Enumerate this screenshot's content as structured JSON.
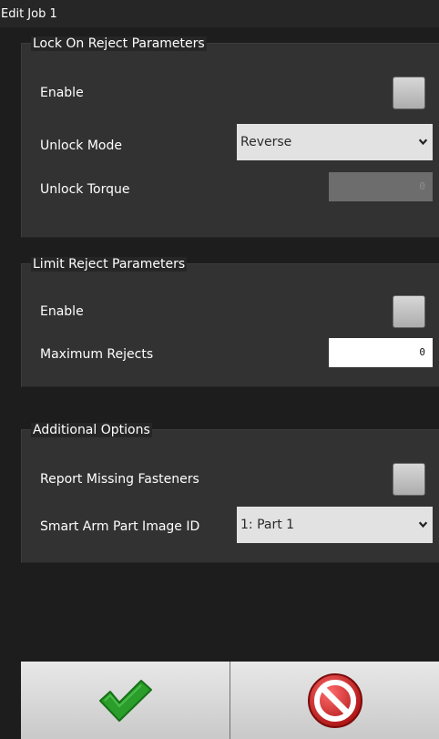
{
  "window": {
    "title": "Edit Job 1"
  },
  "lock_on_reject": {
    "legend": "Lock On Reject Parameters",
    "enable_label": "Enable",
    "enable_checked": false,
    "unlock_mode_label": "Unlock Mode",
    "unlock_mode_value": "Reverse",
    "unlock_torque_label": "Unlock Torque",
    "unlock_torque_value": "0"
  },
  "limit_reject": {
    "legend": "Limit Reject Parameters",
    "enable_label": "Enable",
    "enable_checked": false,
    "max_rejects_label": "Maximum Rejects",
    "max_rejects_value": "0"
  },
  "additional_options": {
    "legend": "Additional Options",
    "report_missing_label": "Report Missing Fasteners",
    "report_missing_checked": false,
    "part_image_label": "Smart Arm Part Image ID",
    "part_image_value": "1: Part 1"
  },
  "footer": {
    "confirm_icon": "checkmark-icon",
    "cancel_icon": "no-entry-icon",
    "confirm_color": "#2a9d2a",
    "cancel_color": "#d22222"
  }
}
